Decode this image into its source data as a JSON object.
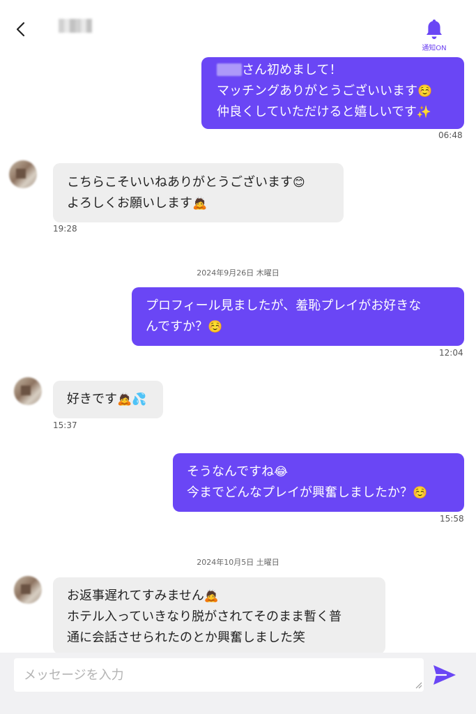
{
  "header": {
    "notify_label": "通知ON"
  },
  "messages": {
    "m1": {
      "prefix": "",
      "l1": "さん初めまして！",
      "l2": "マッチングありがとうございいます",
      "l2_emoji": "☺️",
      "l3": "仲良くしていただけると嬉しいです",
      "l3_emoji": "✨",
      "time": "06:48"
    },
    "m2": {
      "l1": "こちらこそいいねありがとうございます",
      "l1_emoji": "😊",
      "l2": "よろしくお願いします",
      "l2_emoji": "🙇",
      "time": "19:28"
    },
    "date1": "2024年9月26日 木曜日",
    "m3": {
      "l1": "プロフィール見ましたが、羞恥プレイがお好きな",
      "l2": "んですか？",
      "l2_emoji": "☺️",
      "time": "12:04"
    },
    "m4": {
      "l1": "好きです",
      "l1_emoji": "🙇💦",
      "time": "15:37"
    },
    "m5": {
      "l1": "そうなんですね",
      "l1_emoji": "😂",
      "l2": "今までどんなプレイが興奮しましたか？",
      "l2_emoji": "☺️",
      "time": "15:58"
    },
    "date2": "2024年10月5日 土曜日",
    "m6": {
      "l1": "お返事遅れてすみません",
      "l1_emoji": "🙇",
      "l2": "ホテル入っていきなり脱がされてそのまま暫く普",
      "l3": "通に会話させられたのとか興奮しました笑"
    }
  },
  "composer": {
    "placeholder": "メッセージを入力",
    "value": ""
  },
  "colors": {
    "accent": "#6a46f5",
    "incoming_bubble": "#eeeeee",
    "composer_bg": "#f1f1f3"
  },
  "icons": {
    "back": "chevron-left-icon",
    "bell": "bell-icon",
    "send": "send-icon"
  }
}
